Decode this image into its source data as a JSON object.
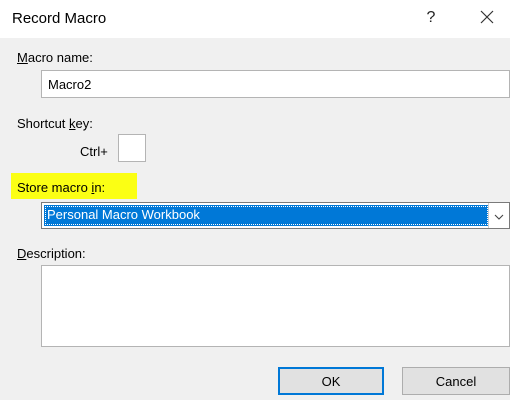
{
  "dialog": {
    "title": "Record Macro",
    "help_label": "?",
    "close_icon": "close-icon"
  },
  "macro_name": {
    "label_key": "M",
    "label_rest": "acro name:",
    "value": "Macro2"
  },
  "shortcut": {
    "label_pre": "Shortcut ",
    "label_key": "k",
    "label_post": "ey:",
    "ctrl_prefix": "Ctrl+",
    "value": ""
  },
  "store_in": {
    "label_pre": "Store macro ",
    "label_key": "i",
    "label_post": "n:",
    "selected": "Personal Macro Workbook",
    "highlight_color": "#fbff14",
    "selection_color": "#0078d7"
  },
  "description": {
    "label_key": "D",
    "label_rest": "escription:",
    "value": ""
  },
  "buttons": {
    "ok": "OK",
    "cancel": "Cancel"
  }
}
